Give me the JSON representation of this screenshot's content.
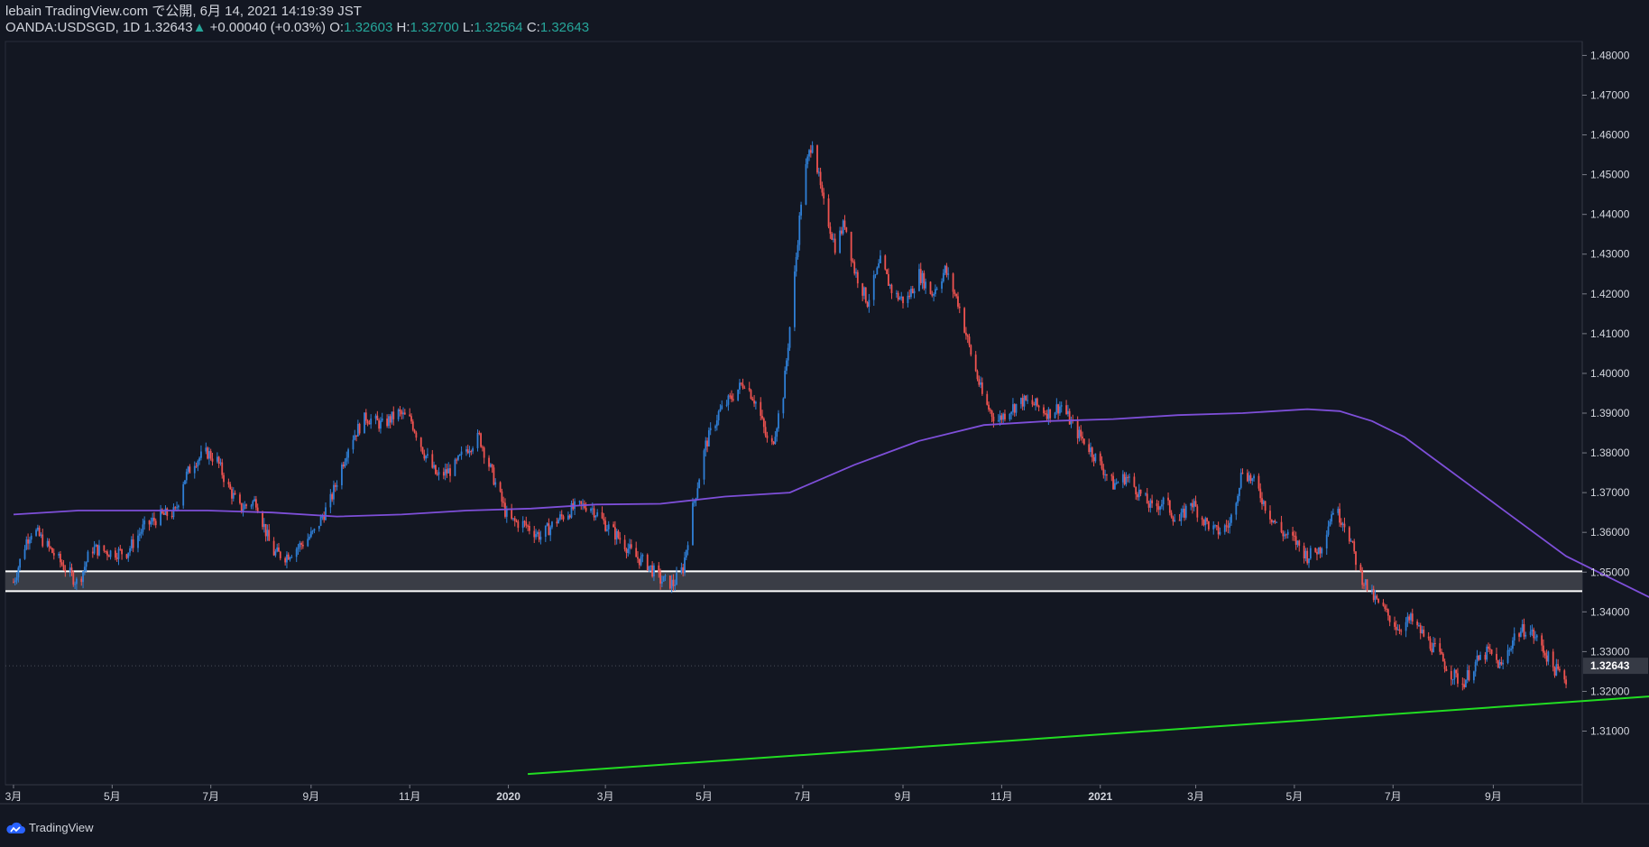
{
  "header": {
    "publisher": "lebain TradingView.com で公開, 6月 14, 2021 14:19:39 JST",
    "symbol_line": "OANDA:USDSGD, 1D 1.32643",
    "change_arrow": "▲",
    "change": "+0.00040 (+0.03%)",
    "o_label": "O:",
    "o_value": "1.32603",
    "h_label": "H:",
    "h_value": "1.32700",
    "l_label": "L:",
    "l_value": "1.32564",
    "c_label": "C:",
    "c_value": "1.32643"
  },
  "footer": {
    "brand": "TradingView",
    "icon": "tradingview-cloud-icon"
  },
  "colors": {
    "background": "#131722",
    "up": "#2f7fd6",
    "down": "#ef5350",
    "ma": "#7e4fd9",
    "trendline": "#22dd22",
    "zone_fill": "#3a3d46",
    "zone_border": "#ffffff",
    "axis_text": "#d1d4dc",
    "teal": "#26a69a"
  },
  "chart_data": {
    "type": "candlestick",
    "symbol": "OANDA:USDSGD",
    "timeframe": "1D",
    "last_price": "1.32643",
    "y_ticks": [
      "1.48000",
      "1.47000",
      "1.46000",
      "1.45000",
      "1.44000",
      "1.43000",
      "1.42000",
      "1.41000",
      "1.40000",
      "1.39000",
      "1.38000",
      "1.37000",
      "1.36000",
      "1.35000",
      "1.34000",
      "1.33000",
      "1.32000",
      "1.31000"
    ],
    "ylim": [
      1.2965,
      1.4835
    ],
    "x_labels": [
      "3月",
      "5月",
      "7月",
      "9月",
      "11月",
      "2020",
      "3月",
      "5月",
      "7月",
      "9月",
      "11月",
      "2021",
      "3月",
      "5月",
      "7月",
      "9月"
    ],
    "x_label_days": [
      0,
      61,
      122,
      184,
      245,
      306,
      366,
      427,
      488,
      550,
      611,
      672,
      731,
      792,
      853,
      915
    ],
    "x_bold": [
      "2020",
      "2021"
    ],
    "x_range_days": [
      -5,
      970
    ],
    "price_series": [
      [
        0,
        1.3475
      ],
      [
        8,
        1.358
      ],
      [
        12,
        1.361
      ],
      [
        22,
        1.356
      ],
      [
        30,
        1.352
      ],
      [
        40,
        1.347
      ],
      [
        48,
        1.356
      ],
      [
        60,
        1.355
      ],
      [
        70,
        1.355
      ],
      [
        80,
        1.361
      ],
      [
        90,
        1.364
      ],
      [
        100,
        1.365
      ],
      [
        105,
        1.373
      ],
      [
        112,
        1.378
      ],
      [
        120,
        1.38
      ],
      [
        126,
        1.378
      ],
      [
        132,
        1.372
      ],
      [
        140,
        1.366
      ],
      [
        150,
        1.368
      ],
      [
        160,
        1.355
      ],
      [
        168,
        1.354
      ],
      [
        178,
        1.357
      ],
      [
        186,
        1.36
      ],
      [
        196,
        1.368
      ],
      [
        208,
        1.383
      ],
      [
        218,
        1.389
      ],
      [
        228,
        1.387
      ],
      [
        238,
        1.39
      ],
      [
        246,
        1.388
      ],
      [
        254,
        1.38
      ],
      [
        262,
        1.374
      ],
      [
        272,
        1.376
      ],
      [
        280,
        1.381
      ],
      [
        288,
        1.384
      ],
      [
        300,
        1.37
      ],
      [
        306,
        1.363
      ],
      [
        316,
        1.362
      ],
      [
        326,
        1.359
      ],
      [
        336,
        1.363
      ],
      [
        346,
        1.366
      ],
      [
        356,
        1.367
      ],
      [
        366,
        1.362
      ],
      [
        376,
        1.358
      ],
      [
        384,
        1.354
      ],
      [
        392,
        1.352
      ],
      [
        400,
        1.348
      ],
      [
        408,
        1.347
      ],
      [
        414,
        1.351
      ],
      [
        420,
        1.366
      ],
      [
        428,
        1.382
      ],
      [
        436,
        1.39
      ],
      [
        446,
        1.395
      ],
      [
        452,
        1.398
      ],
      [
        460,
        1.392
      ],
      [
        468,
        1.38
      ],
      [
        476,
        1.395
      ],
      [
        482,
        1.42
      ],
      [
        488,
        1.448
      ],
      [
        494,
        1.459
      ],
      [
        500,
        1.444
      ],
      [
        508,
        1.432
      ],
      [
        514,
        1.438
      ],
      [
        520,
        1.426
      ],
      [
        528,
        1.418
      ],
      [
        536,
        1.428
      ],
      [
        544,
        1.42
      ],
      [
        552,
        1.418
      ],
      [
        560,
        1.425
      ],
      [
        568,
        1.42
      ],
      [
        576,
        1.426
      ],
      [
        584,
        1.418
      ],
      [
        592,
        1.405
      ],
      [
        600,
        1.393
      ],
      [
        608,
        1.388
      ],
      [
        616,
        1.391
      ],
      [
        624,
        1.393
      ],
      [
        632,
        1.392
      ],
      [
        640,
        1.39
      ],
      [
        648,
        1.392
      ],
      [
        656,
        1.386
      ],
      [
        664,
        1.382
      ],
      [
        672,
        1.377
      ],
      [
        680,
        1.372
      ],
      [
        688,
        1.374
      ],
      [
        696,
        1.37
      ],
      [
        704,
        1.366
      ],
      [
        712,
        1.368
      ],
      [
        720,
        1.362
      ],
      [
        728,
        1.368
      ],
      [
        736,
        1.363
      ],
      [
        744,
        1.36
      ],
      [
        752,
        1.362
      ],
      [
        760,
        1.376
      ],
      [
        768,
        1.372
      ],
      [
        776,
        1.365
      ],
      [
        784,
        1.36
      ],
      [
        792,
        1.358
      ],
      [
        800,
        1.354
      ],
      [
        808,
        1.356
      ],
      [
        816,
        1.366
      ],
      [
        824,
        1.362
      ],
      [
        832,
        1.35
      ],
      [
        840,
        1.344
      ],
      [
        848,
        1.34
      ],
      [
        856,
        1.336
      ],
      [
        864,
        1.338
      ],
      [
        872,
        1.334
      ],
      [
        880,
        1.33
      ],
      [
        888,
        1.325
      ],
      [
        896,
        1.322
      ],
      [
        904,
        1.327
      ],
      [
        912,
        1.33
      ],
      [
        920,
        1.326
      ],
      [
        928,
        1.334
      ],
      [
        936,
        1.336
      ],
      [
        944,
        1.332
      ],
      [
        952,
        1.326
      ],
      [
        960,
        1.323
      ]
    ],
    "ma_series": [
      [
        0,
        1.3645
      ],
      [
        40,
        1.3655
      ],
      [
        80,
        1.3655
      ],
      [
        120,
        1.3655
      ],
      [
        160,
        1.365
      ],
      [
        200,
        1.364
      ],
      [
        240,
        1.3645
      ],
      [
        280,
        1.3655
      ],
      [
        320,
        1.366
      ],
      [
        360,
        1.367
      ],
      [
        400,
        1.3672
      ],
      [
        440,
        1.369
      ],
      [
        480,
        1.37
      ],
      [
        520,
        1.377
      ],
      [
        560,
        1.383
      ],
      [
        600,
        1.387
      ],
      [
        640,
        1.388
      ],
      [
        680,
        1.3885
      ],
      [
        720,
        1.3895
      ],
      [
        760,
        1.39
      ],
      [
        800,
        1.391
      ],
      [
        820,
        1.3905
      ],
      [
        840,
        1.388
      ],
      [
        860,
        1.384
      ],
      [
        880,
        1.378
      ],
      [
        900,
        1.372
      ],
      [
        920,
        1.366
      ],
      [
        940,
        1.36
      ],
      [
        960,
        1.354
      ],
      [
        980,
        1.35
      ],
      [
        1000,
        1.346
      ],
      [
        1020,
        1.342
      ],
      [
        1040,
        1.34
      ]
    ],
    "zone": {
      "top": 1.3502,
      "bottom": 1.3452
    },
    "trendline": {
      "from": [
        318,
        1.2992
      ],
      "to": [
        1260,
        1.3257
      ]
    },
    "annotations": []
  }
}
